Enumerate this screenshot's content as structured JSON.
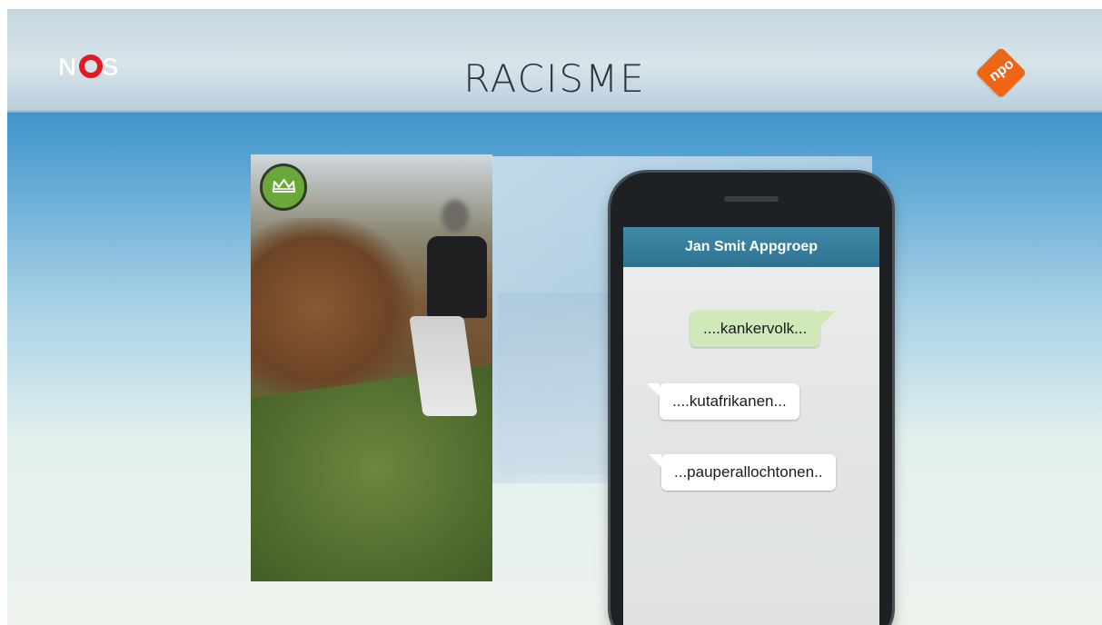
{
  "header": {
    "channel_logo": "NOS",
    "title": "RACISME",
    "broadcaster_logo": "npo"
  },
  "colors": {
    "header_bg": "#cfdde5",
    "accent_orange": "#f06415",
    "chat_header": "#357c9a",
    "sent_bubble": "#cfe9b8"
  },
  "photo": {
    "badge_icon": "crown-icon"
  },
  "phone": {
    "chat_title": "Jan Smit Appgroep",
    "messages": [
      {
        "type": "sent",
        "text": "....kankervolk..."
      },
      {
        "type": "received",
        "text": "....kutafrikanen..."
      },
      {
        "type": "received",
        "text": "...pauperallochtonen.."
      }
    ]
  }
}
